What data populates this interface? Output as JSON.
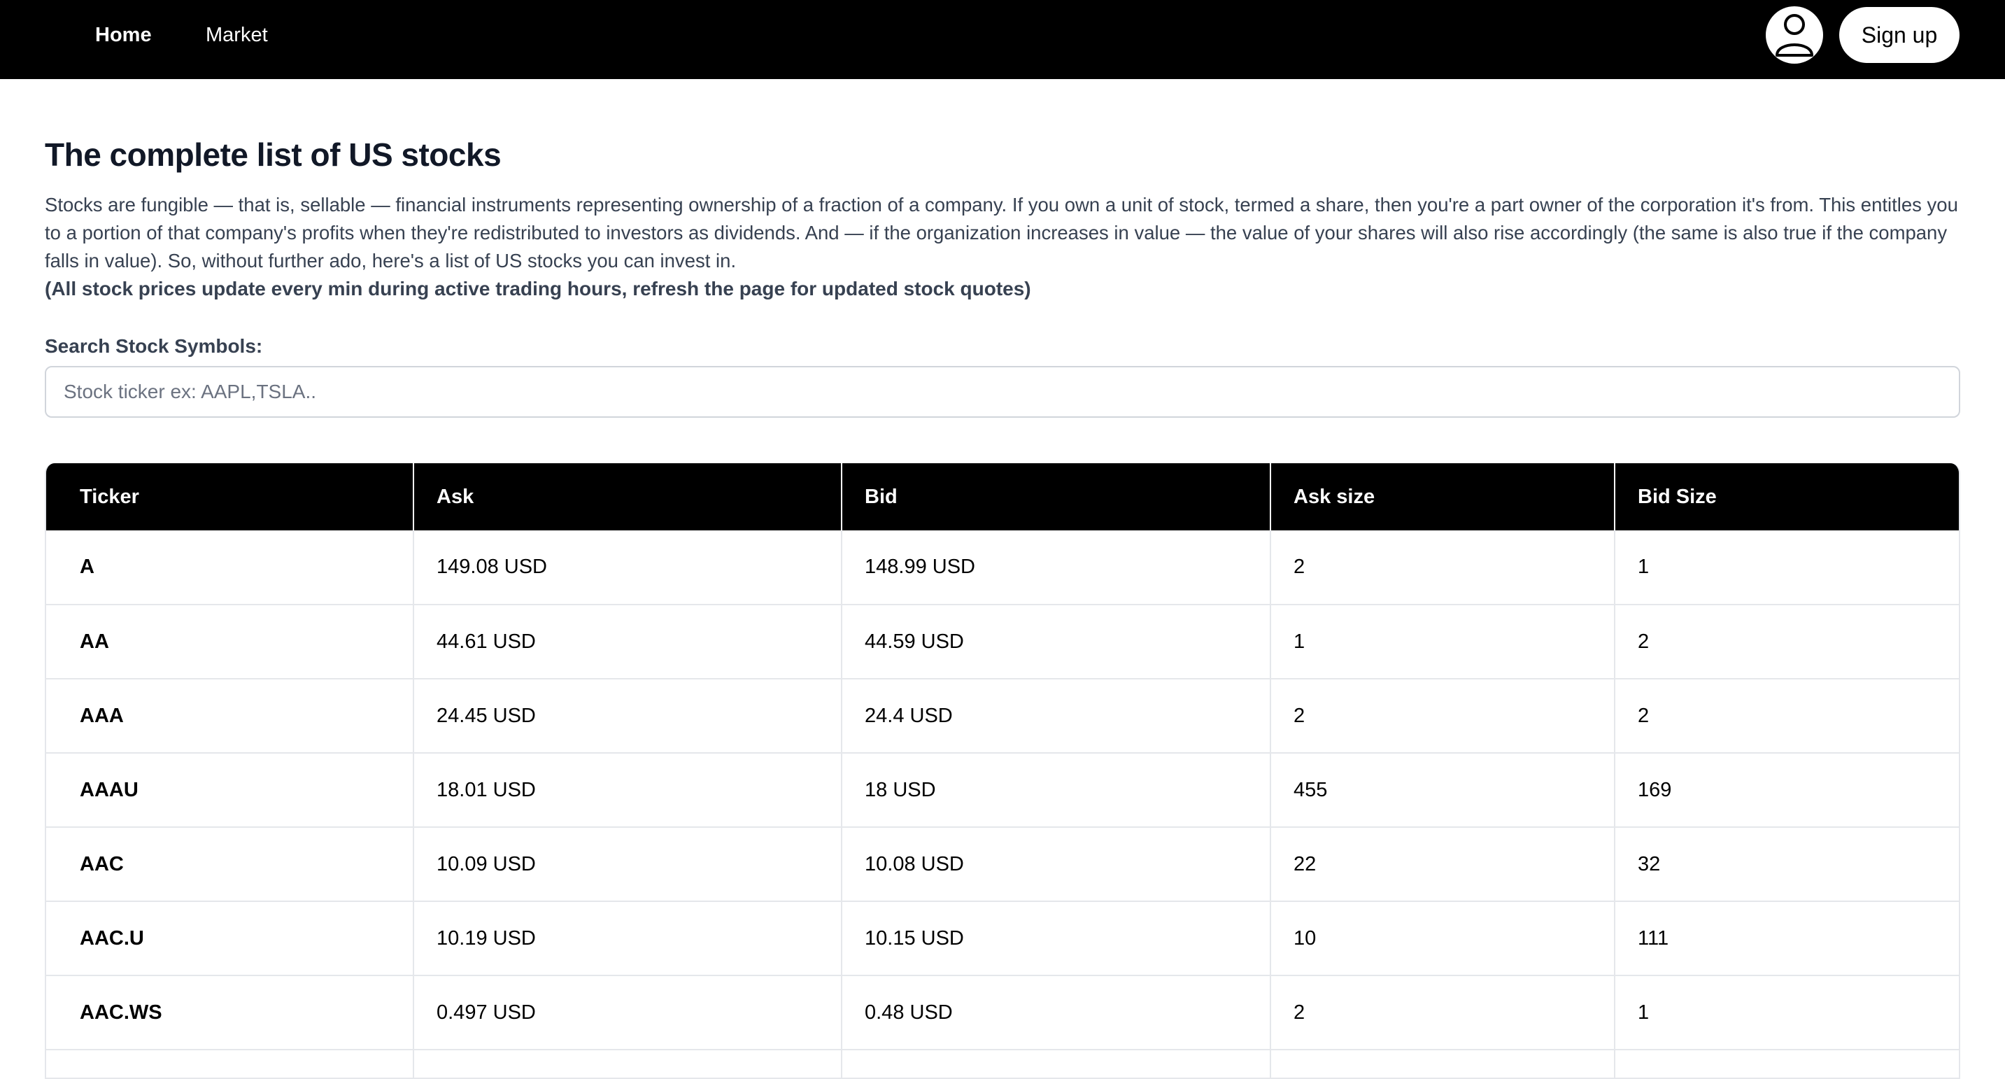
{
  "nav": {
    "links": [
      "Home",
      "Market"
    ],
    "signup_label": "Sign up",
    "avatar_icon": "user-icon"
  },
  "page": {
    "title": "The complete list of US stocks",
    "intro": "Stocks are fungible — that is, sellable — financial instruments representing ownership of a fraction of a company. If you own a unit of stock, termed a share, then you're a part owner of the corporation it's from. This entitles you to a portion of that company's profits when they're redistributed to investors as dividends. And — if the organization increases in value — the value of your shares will also rise accordingly (the same is also true if the company falls in value). So, without further ado, here's a list of US stocks you can invest in.",
    "note": "(All stock prices update every min during active trading hours, refresh the page for updated stock quotes)"
  },
  "search": {
    "label": "Search Stock Symbols:",
    "placeholder": "Stock ticker ex: AAPL,TSLA..",
    "value": ""
  },
  "table": {
    "headers": [
      "Ticker",
      "Ask",
      "Bid",
      "Ask size",
      "Bid Size"
    ],
    "rows": [
      [
        "A",
        "149.08 USD",
        "148.99 USD",
        "2",
        "1"
      ],
      [
        "AA",
        "44.61 USD",
        "44.59 USD",
        "1",
        "2"
      ],
      [
        "AAA",
        "24.45 USD",
        "24.4 USD",
        "2",
        "2"
      ],
      [
        "AAAU",
        "18.01 USD",
        "18 USD",
        "455",
        "169"
      ],
      [
        "AAC",
        "10.09 USD",
        "10.08 USD",
        "22",
        "32"
      ],
      [
        "AAC.U",
        "10.19 USD",
        "10.15 USD",
        "10",
        "111"
      ],
      [
        "AAC.WS",
        "0.497 USD",
        "0.48 USD",
        "2",
        "1"
      ],
      [
        "",
        "",
        "",
        "",
        ""
      ]
    ]
  },
  "colors": {
    "navbar_bg": "#000000",
    "header_bg": "#000000",
    "text": "#111827",
    "border": "#e5e7eb"
  }
}
